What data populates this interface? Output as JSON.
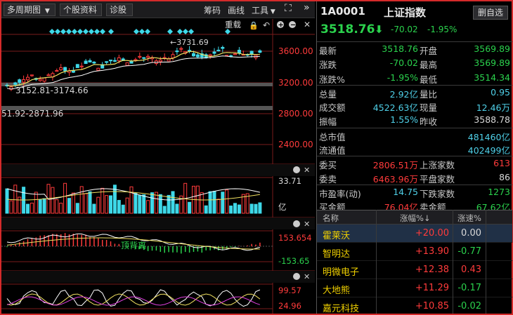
{
  "toolbar": {
    "period": "多周期图",
    "stock_info": "个股资料",
    "diagnose": "诊股",
    "chips": "筹码",
    "draw": "画线",
    "tools": "工具"
  },
  "chart": {
    "reload": "重载",
    "high_label": "←3731.69",
    "range_label_1": "3152.81-3174.66",
    "range_label_2": "51.92-2871.96",
    "price_ticks": [
      "3600.00",
      "3200.00",
      "2800.00",
      "2400.00"
    ],
    "volume_top": "33.71",
    "volume_unit": "亿",
    "macd_top": "153.654",
    "macd_bottom": "-153.65",
    "macd_annotation": "顶背离",
    "osc_top": "99.57",
    "osc_bottom": "24.96"
  },
  "chart_data": [
    {
      "type": "line",
      "ytick_labels": [
        "3600.00",
        "3200.00",
        "2800.00",
        "2400.00"
      ],
      "annotations": [
        "←3731.69",
        "3152.81-3174.66",
        "51.92-2871.96"
      ]
    },
    {
      "type": "bar",
      "ytick_labels": [
        "33.71",
        "亿"
      ]
    },
    {
      "type": "bar",
      "ytick_labels": [
        "153.654",
        "-153.65"
      ],
      "annotations": [
        "顶背离"
      ]
    },
    {
      "type": "line",
      "ytick_labels": [
        "99.57",
        "24.96"
      ]
    }
  ],
  "quote": {
    "code": "1A0001",
    "name": "上证指数",
    "delete_btn": "删自选",
    "price": "3518.76",
    "change": "-70.02",
    "pct": "-1.95%",
    "rows": [
      [
        "最新",
        "3518.76",
        "green",
        "开盘",
        "3569.89",
        "green"
      ],
      [
        "涨跌",
        "-70.02",
        "green",
        "最高",
        "3569.89",
        "green"
      ],
      [
        "涨跌%",
        "-1.95%",
        "green",
        "最低",
        "3514.34",
        "green"
      ],
      [
        "总量",
        "2.92亿",
        "cyan",
        "量比",
        "0.95",
        "cyan"
      ],
      [
        "成交额",
        "4522.63亿",
        "cyan",
        "现量",
        "12.46万",
        "cyan"
      ],
      [
        "振幅",
        "1.55%",
        "cyan",
        "昨收",
        "3588.78",
        "white"
      ],
      [
        "总市值",
        "",
        "white",
        "",
        "481460亿",
        "cyan"
      ],
      [
        "流通值",
        "",
        "white",
        "",
        "402499亿",
        "cyan"
      ],
      [
        "委买",
        "2806.51万",
        "red",
        "上涨家数",
        "613",
        "red"
      ],
      [
        "委卖",
        "6463.96万",
        "red",
        "平盘家数",
        "86",
        "white"
      ],
      [
        "市盈率(动)",
        "14.75",
        "cyan",
        "下跌家数",
        "1273",
        "green"
      ],
      [
        "买金额",
        "76.04亿",
        "red",
        "卖金额",
        "67.62亿",
        "green"
      ]
    ]
  },
  "ranking": {
    "headers": [
      "名称",
      "涨幅%↓",
      "涨速%"
    ],
    "rows": [
      [
        "霍莱沃",
        "+20.00",
        "0.00",
        "white"
      ],
      [
        "智明达",
        "+13.90",
        "-0.77",
        "green"
      ],
      [
        "明微电子",
        "+12.38",
        "0.43",
        "red"
      ],
      [
        "大地熊",
        "+11.29",
        "-0.17",
        "green"
      ],
      [
        "嘉元科技",
        "+10.85",
        "-0.02",
        "green"
      ]
    ]
  }
}
